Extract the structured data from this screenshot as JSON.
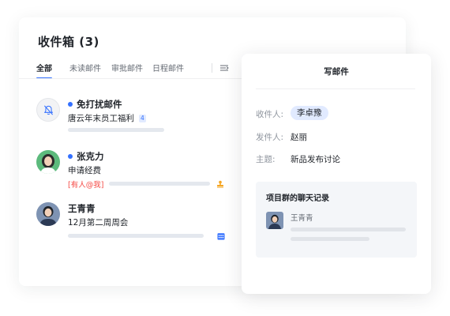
{
  "inbox": {
    "title": "收件箱 (3)",
    "tabs": [
      {
        "label": "全部",
        "active": true
      },
      {
        "label": "未读邮件",
        "active": false
      },
      {
        "label": "审批邮件",
        "active": false
      },
      {
        "label": "日程邮件",
        "active": false
      }
    ],
    "mails": [
      {
        "sender": "免打扰邮件",
        "unread": true,
        "subject": "唐云年末员工福利",
        "count": "4",
        "avatar_icon": "bell-off-icon"
      },
      {
        "sender": "张克力",
        "unread": true,
        "subject": "申请经费",
        "tag": "[有人@我]",
        "action_icon": "stamp-icon"
      },
      {
        "sender": "王青青",
        "unread": false,
        "subject": "12月第二周周会",
        "action_icon": "calendar-icon"
      }
    ]
  },
  "compose": {
    "title": "写邮件",
    "to_label": "收件人:",
    "to_value": "李卓豫",
    "from_label": "发件人:",
    "from_value": "赵丽",
    "subject_label": "主题:",
    "subject_value": "新品发布讨论",
    "chat_record": {
      "title": "项目群的聊天记录",
      "sender": "王青青"
    }
  },
  "colors": {
    "accent": "#3370ff",
    "accent_light": "#e1eaff",
    "mention": "#f54a45",
    "action_icon": "#f5a623"
  }
}
